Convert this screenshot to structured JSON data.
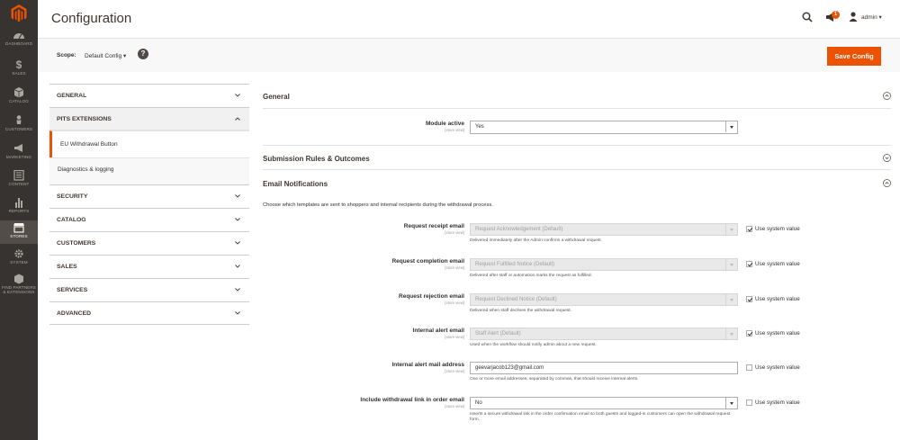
{
  "nav": {
    "items": [
      {
        "label": "DASHBOARD",
        "icon": "dashboard-icon"
      },
      {
        "label": "SALES",
        "icon": "dollar-icon"
      },
      {
        "label": "CATALOG",
        "icon": "box-icon"
      },
      {
        "label": "CUSTOMERS",
        "icon": "person-icon"
      },
      {
        "label": "MARKETING",
        "icon": "megaphone-icon"
      },
      {
        "label": "CONTENT",
        "icon": "layout-icon"
      },
      {
        "label": "REPORTS",
        "icon": "bar-chart-icon"
      },
      {
        "label": "STORES",
        "icon": "store-icon"
      },
      {
        "label": "SYSTEM",
        "icon": "gear-icon"
      },
      {
        "label": "FIND PARTNERS",
        "label2": "& EXTENSIONS",
        "icon": "cube-icon"
      }
    ]
  },
  "header": {
    "title": "Configuration",
    "notification_count": "1",
    "user": "admin ▾"
  },
  "scope": {
    "label": "Scope:",
    "value": "Default Config ▾",
    "help": "?"
  },
  "toolbar": {
    "save_label": "Save Config"
  },
  "tabs": {
    "general": "GENERAL",
    "pits": "PITS EXTENSIONS",
    "eu_withdrawal": "EU Withdrawal Button",
    "diagnostics": "Diagnostics & logging",
    "security": "SECURITY",
    "catalog": "CATALOG",
    "customers": "CUSTOMERS",
    "sales": "SALES",
    "services": "SERVICES",
    "advanced": "ADVANCED"
  },
  "sections": {
    "general": "General",
    "submission": "Submission Rules & Outcomes",
    "email": "Email Notifications"
  },
  "store_view": "[store view]",
  "use_system_value": "Use system value",
  "fields": {
    "module_active": {
      "label": "Module active",
      "value": "Yes"
    },
    "email_desc": "Choose which templates are sent to shoppers and internal recipients during the withdrawal process.",
    "receipt": {
      "label": "Request receipt email",
      "value": "Request Acknowledgement (Default)",
      "hint": "Delivered immediately after the Admin confirms a withdrawal request.",
      "checked": true
    },
    "completion": {
      "label": "Request completion email",
      "value": "Request Fulfilled Notice (Default)",
      "hint": "Delivered after staff or automation marks the request as fulfilled.",
      "checked": true
    },
    "rejection": {
      "label": "Request rejection email",
      "value": "Request Declined Notice (Default)",
      "hint": "Delivered when staff declines the withdrawal request.",
      "checked": true
    },
    "internal_alert": {
      "label": "Internal alert email",
      "value": "Staff Alert (Default)",
      "hint": "Used when the workflow should notify admin about a new request.",
      "checked": true
    },
    "internal_address": {
      "label": "Internal alert mail address",
      "value": "geevarjacob123@gmail.com",
      "hint": "One or more email addresses, separated by commas, that should receive internal alerts.",
      "checked": false
    },
    "include_link": {
      "label": "Include withdrawal link in order email",
      "value": "No",
      "hint": "Inserts a secure withdrawal link in the order confirmation email so both guests and logged-in customers can open the withdrawal request form.",
      "checked": false
    }
  },
  "colors": {
    "accent": "#eb5202",
    "nav_bg": "#373330"
  }
}
